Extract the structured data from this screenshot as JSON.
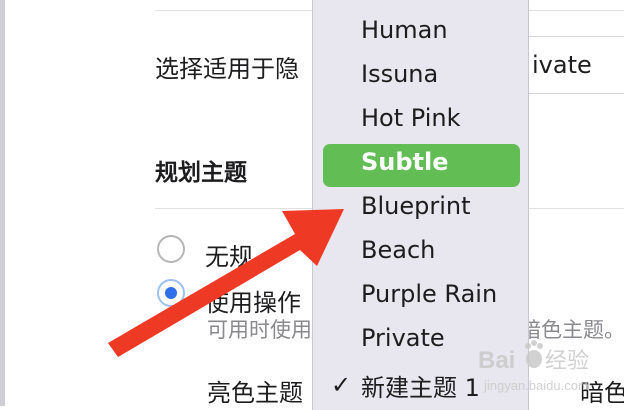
{
  "settings": {
    "privacy_label_visible": "选择适用于隐",
    "privacy_value_visible": "ivate",
    "section_title": "规划主题",
    "radio_none_visible": "无规",
    "radio_use_visible": "使用操作",
    "hint_left_visible": "可用时使用",
    "hint_right_visible": "暗色主题。",
    "light_theme_label": "亮色主题",
    "dark_theme_visible": "暗色"
  },
  "menu": {
    "items": [
      "Human",
      "Issuna",
      "Hot Pink",
      "Subtle",
      "Blueprint",
      "Beach",
      "Purple Rain",
      "Private"
    ],
    "highlighted": "Subtle",
    "checked_item": "新建主题 1",
    "check_icon": "checkmark-icon"
  },
  "colors": {
    "highlight": "#62bd55",
    "menu_bg": "#e8e6ee",
    "arrow": "#ee3a24",
    "radio_selected": "#2f6fe8"
  },
  "watermark": {
    "brand": "Bai",
    "brand_suffix": "经验",
    "url": "jingyan.baidu.com",
    "icon": "baidu-paw-icon"
  }
}
